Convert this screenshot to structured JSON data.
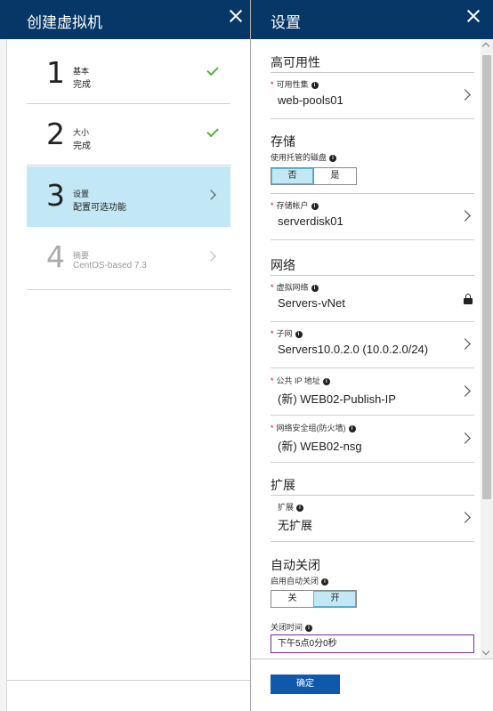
{
  "left_blade": {
    "title": "创建虚拟机",
    "steps": [
      {
        "number": "1",
        "title": "基本",
        "subtitle": "完成",
        "state": "done",
        "status_icon": "checkmark-icon"
      },
      {
        "number": "2",
        "title": "大小",
        "subtitle": "完成",
        "state": "done",
        "status_icon": "checkmark-icon"
      },
      {
        "number": "3",
        "title": "设置",
        "subtitle": "配置可选功能",
        "state": "active",
        "status_icon": "chevron-right-icon"
      },
      {
        "number": "4",
        "title": "摘要",
        "subtitle": "CentOS-based 7.3",
        "state": "disabled",
        "status_icon": "chevron-right-icon"
      }
    ]
  },
  "right_blade": {
    "title": "设置",
    "high_availability": {
      "heading": "高可用性",
      "availability_set": {
        "label": "可用性集",
        "value": "web-pools01"
      }
    },
    "storage": {
      "heading": "存储",
      "managed_disks_label": "使用托管的磁盘",
      "managed_disks_options": [
        "否",
        "是"
      ],
      "managed_disks_selected": "否",
      "storage_account": {
        "label": "存储帐户",
        "value": "serverdisk01"
      }
    },
    "network": {
      "heading": "网络",
      "virtual_network": {
        "label": "虚拟网络",
        "value": "Servers-vNet"
      },
      "subnet": {
        "label": "子网",
        "value": "Servers10.0.2.0 (10.0.2.0/24)"
      },
      "public_ip": {
        "label": "公共 IP 地址",
        "value": "(新) WEB02-Publish-IP"
      },
      "nsg": {
        "label": "网络安全组(防火墙)",
        "value": "(新) WEB02-nsg"
      }
    },
    "extensions": {
      "heading": "扩展",
      "extensions_field": {
        "label": "扩展",
        "value": "无扩展"
      }
    },
    "auto_shutdown": {
      "heading": "自动关闭",
      "enable_label": "启用自动关闭",
      "enable_options": [
        "关",
        "开"
      ],
      "enable_selected": "开",
      "time_label": "关闭时间",
      "time_value": "下午5点0分0秒"
    },
    "ok_label": "确定"
  },
  "colors": {
    "header_bg": "#063767",
    "active_bg": "#c2e8f5",
    "check_green": "#59b13a",
    "required_red": "#e0001b",
    "ok_button": "#0f59ad"
  }
}
